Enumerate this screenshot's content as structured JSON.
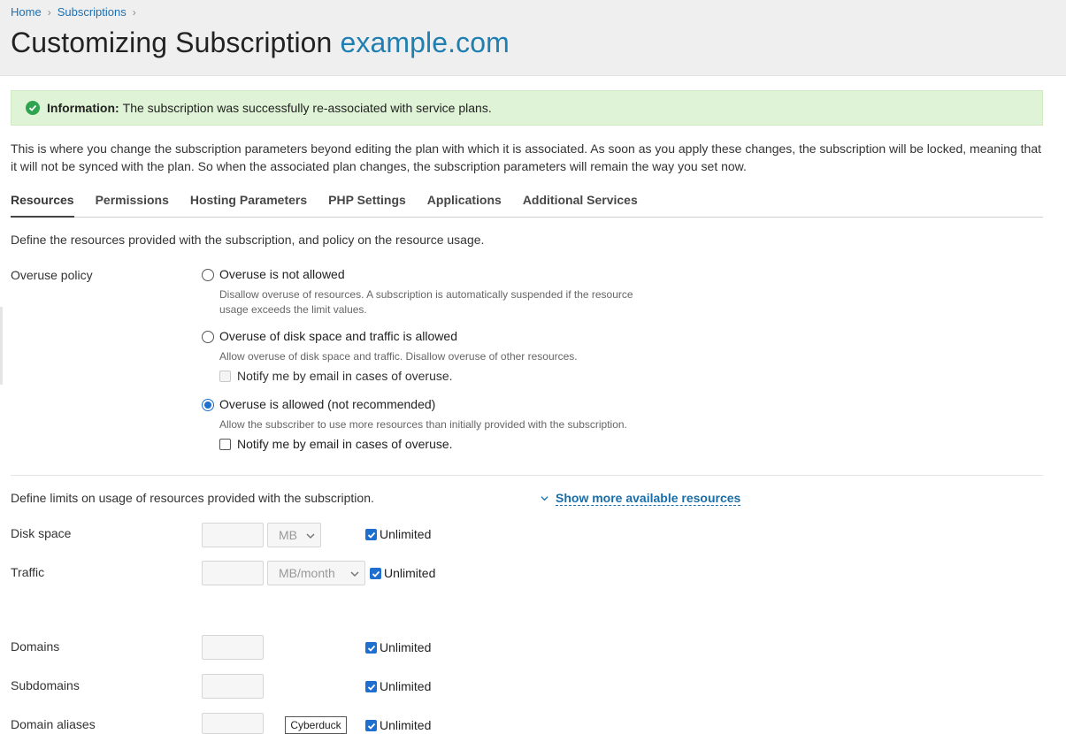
{
  "breadcrumb": {
    "home": "Home",
    "subscriptions": "Subscriptions",
    "sep": ">"
  },
  "title": {
    "prefix": "Customizing Subscription",
    "domain": "example.com"
  },
  "info": {
    "label": "Information:",
    "text": "The subscription was successfully re-associated with service plans."
  },
  "description": "This is where you change the subscription parameters beyond editing the plan with which it is associated. As soon as you apply these changes, the subscription will be locked, meaning that it will not be synced with the plan. So when the associated plan changes, the subscription parameters will remain the way you set now.",
  "tabs": [
    {
      "label": "Resources",
      "active": true
    },
    {
      "label": "Permissions"
    },
    {
      "label": "Hosting Parameters"
    },
    {
      "label": "PHP Settings"
    },
    {
      "label": "Applications"
    },
    {
      "label": "Additional Services"
    }
  ],
  "resources_description": "Define the resources provided with the subscription, and policy on the resource usage.",
  "overuse": {
    "label": "Overuse policy",
    "options": [
      {
        "label": "Overuse is not allowed",
        "hint": "Disallow overuse of resources. A subscription is automatically suspended if the resource usage exceeds the limit values.",
        "checked": false
      },
      {
        "label": "Overuse of disk space and traffic is allowed",
        "hint": "Allow overuse of disk space and traffic. Disallow overuse of other resources.",
        "notify": "Notify me by email in cases of overuse.",
        "checked": false
      },
      {
        "label": "Overuse is allowed (not recommended)",
        "hint": "Allow the subscriber to use more resources than initially provided with the subscription.",
        "notify": "Notify me by email in cases of overuse.",
        "checked": true
      }
    ]
  },
  "limits": {
    "description": "Define limits on usage of resources provided with the subscription.",
    "show_more": "Show more available resources",
    "unlimited": "Unlimited",
    "rows": [
      {
        "label": "Disk space",
        "unit": "MB"
      },
      {
        "label": "Traffic",
        "unit": "MB/month"
      },
      {
        "label": "Domains"
      },
      {
        "label": "Subdomains"
      },
      {
        "label": "Domain aliases"
      }
    ]
  },
  "tooltip": "Cyberduck",
  "colors": {
    "accent": "#1f6fd1",
    "link": "#1a6ea8",
    "success_bg": "#dff3d6",
    "success_icon": "#2ea44f"
  }
}
